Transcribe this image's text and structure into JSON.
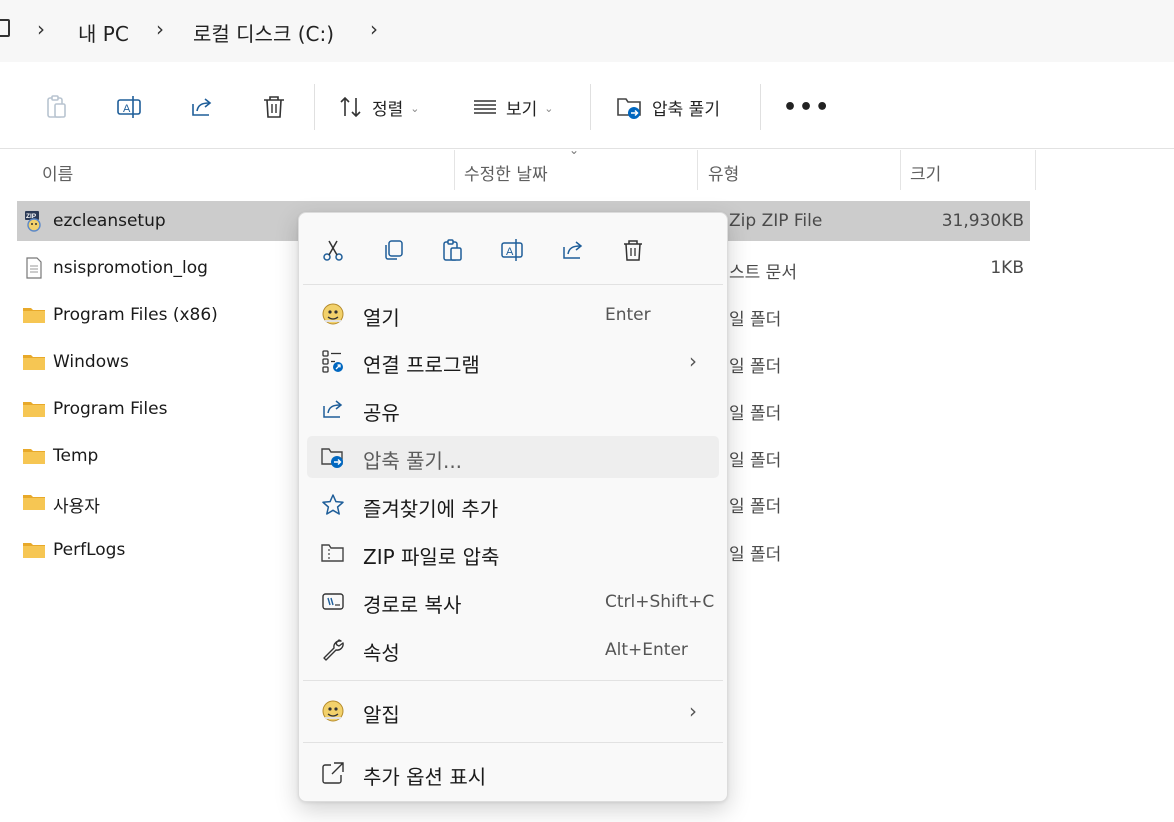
{
  "breadcrumb": {
    "items": [
      "내 PC",
      "로컬 디스크 (C:)"
    ]
  },
  "toolbar": {
    "sort_label": "정렬",
    "view_label": "보기",
    "extract_label": "압축 풀기",
    "more_label": "•••"
  },
  "columns": {
    "name": "이름",
    "date": "수정한 날짜",
    "type": "유형",
    "size": "크기"
  },
  "files": [
    {
      "name": "ezcleansetup",
      "type": "Zip ZIP File",
      "size": "31,930KB",
      "icon": "zip-icon",
      "selected": true
    },
    {
      "name": "nsispromotion_log",
      "type": "스트 문서",
      "size": "1KB",
      "icon": "text-file-icon"
    },
    {
      "name": "Program Files (x86)",
      "type": "일 폴더",
      "size": "",
      "icon": "folder-icon"
    },
    {
      "name": "Windows",
      "type": "일 폴더",
      "size": "",
      "icon": "folder-icon"
    },
    {
      "name": "Program Files",
      "type": "일 폴더",
      "size": "",
      "icon": "folder-icon"
    },
    {
      "name": "Temp",
      "type": "일 폴더",
      "size": "",
      "icon": "folder-icon"
    },
    {
      "name": "사용자",
      "type": "일 폴더",
      "size": "",
      "icon": "folder-icon"
    },
    {
      "name": "PerfLogs",
      "type": "일 폴더",
      "size": "",
      "icon": "folder-icon"
    }
  ],
  "context_menu": {
    "quick_actions": [
      "scissors-icon",
      "copy-icon",
      "paste-icon",
      "rename-icon",
      "share-icon",
      "trash-icon"
    ],
    "items": [
      {
        "label": "열기",
        "shortcut": "Enter",
        "icon": "alzip-icon"
      },
      {
        "label": "연결 프로그램",
        "submenu": true,
        "icon": "open-with-icon"
      },
      {
        "label": "공유",
        "icon": "share-icon"
      },
      {
        "label": "압축 풀기...",
        "icon": "extract-icon",
        "hover": true
      },
      {
        "label": "즐겨찾기에 추가",
        "icon": "star-icon"
      },
      {
        "label": "ZIP 파일로 압축",
        "icon": "zip-folder-icon"
      },
      {
        "label": "경로로 복사",
        "shortcut": "Ctrl+Shift+C",
        "icon": "copy-path-icon"
      },
      {
        "label": "속성",
        "shortcut": "Alt+Enter",
        "icon": "wrench-icon"
      },
      {
        "label": "알집",
        "submenu": true,
        "icon": "alzip-icon"
      },
      {
        "label": "추가 옵션 표시",
        "icon": "more-options-icon"
      }
    ],
    "submenu_arrow": "›"
  },
  "colors": {
    "accent": "#0067c0",
    "selection": "#cccccc",
    "folder": "#f4c14d"
  }
}
